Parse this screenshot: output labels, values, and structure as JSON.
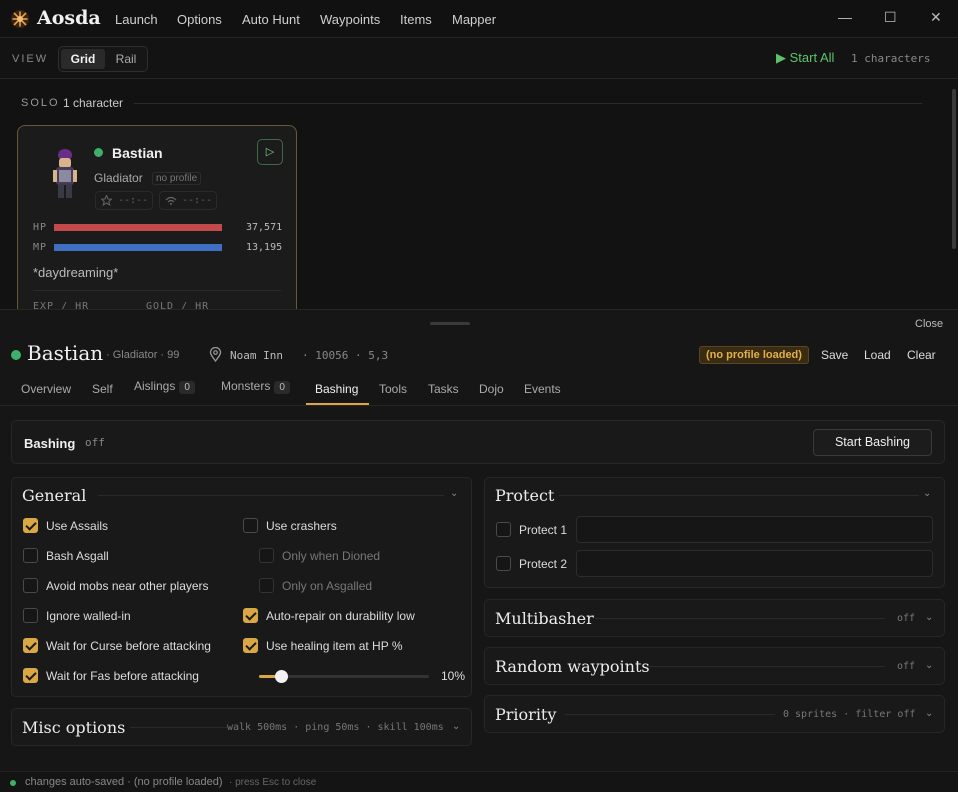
{
  "app": {
    "title": "Aosda"
  },
  "menu": [
    "Launch",
    "Options",
    "Auto Hunt",
    "Waypoints",
    "Items",
    "Mapper"
  ],
  "window_controls": {
    "minimize": "—",
    "maximize": "☐",
    "close": "✕"
  },
  "view": {
    "label": "VIEW",
    "grid": "Grid",
    "rail": "Rail",
    "selected": "Grid"
  },
  "toolbar": {
    "start_all": "Start All",
    "character_count": "1 characters"
  },
  "solo": {
    "label": "SOLO",
    "count": "1 character"
  },
  "card": {
    "name": "Bastian",
    "status_color": "#3fb06a",
    "class": "Gladiator",
    "profile": "no profile",
    "pill1": "--:--",
    "pill2": "--:--",
    "hp_label": "HP",
    "hp_value": "37,571",
    "hp_fraction": 1.0,
    "hp_color": "#c24a4a",
    "mp_label": "MP",
    "mp_value": "13,195",
    "mp_fraction": 1.0,
    "mp_color": "#3f6fc2",
    "status_text": "*daydreaming*",
    "exp_label": "EXP / HR",
    "gold_label": "GOLD / HR"
  },
  "detail": {
    "close": "Close",
    "name": "Bastian",
    "meta": "· Gladiator ·  99",
    "location": "Noam Inn",
    "location_rest": "·  10056  ·  5,3",
    "profile_badge": "(no profile loaded)",
    "save": "Save",
    "load": "Load",
    "clear": "Clear",
    "tabs": [
      {
        "label": "Overview"
      },
      {
        "label": "Self"
      },
      {
        "label": "Aislings",
        "count": "0"
      },
      {
        "label": "Monsters",
        "count": "0"
      },
      {
        "label": "Bashing",
        "active": true
      },
      {
        "label": "Tools"
      },
      {
        "label": "Tasks"
      },
      {
        "label": "Dojo"
      },
      {
        "label": "Events"
      }
    ]
  },
  "bashing": {
    "title": "Bashing",
    "state": "off",
    "start_button": "Start Bashing"
  },
  "general": {
    "title": "General",
    "options": [
      {
        "label": "Use Assails",
        "checked": true
      },
      {
        "label": "Use crashers",
        "checked": false
      },
      {
        "label": "Bash Asgall",
        "checked": false
      },
      {
        "label": "Only when Dioned",
        "checked": false,
        "disabled": true
      },
      {
        "label": "Avoid mobs near other players",
        "checked": false
      },
      {
        "label": "Only on Asgalled",
        "checked": false,
        "disabled": true
      },
      {
        "label": "Ignore walled-in",
        "checked": false
      },
      {
        "label": "Auto-repair on durability low",
        "checked": true
      },
      {
        "label": "Wait for Curse before attacking",
        "checked": true
      },
      {
        "label": "Use healing item at HP %",
        "checked": true
      },
      {
        "label": "Wait for Fas before attacking",
        "checked": true
      }
    ],
    "heal_slider": {
      "value": 10,
      "max": 100,
      "display": "10%"
    }
  },
  "misc": {
    "title": "Misc options",
    "summary": "walk 500ms · ping 50ms · skill 100ms"
  },
  "protect": {
    "title": "Protect",
    "items": [
      {
        "label": "Protect 1",
        "value": ""
      },
      {
        "label": "Protect 2",
        "value": ""
      }
    ]
  },
  "multibasher": {
    "title": "Multibasher",
    "state": "off"
  },
  "random_waypoints": {
    "title": "Random waypoints",
    "state": "off"
  },
  "priority": {
    "title": "Priority",
    "summary": "0 sprites · filter off"
  },
  "footer": {
    "text": "changes auto-saved ·  (no profile loaded)",
    "hint": "· press Esc to close"
  },
  "colors": {
    "accent": "#d9a844",
    "green": "#3fb06a",
    "hp": "#c24a4a",
    "mp": "#3f6fc2"
  }
}
